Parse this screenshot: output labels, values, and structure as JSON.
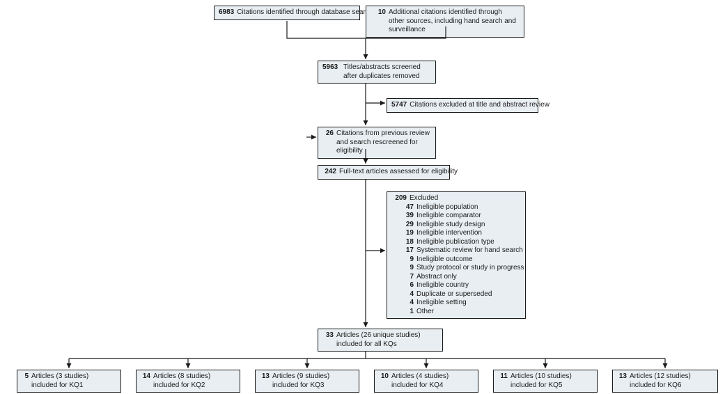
{
  "chart_data": {
    "type": "flow",
    "nodes": {
      "db_search": {
        "n": "6983",
        "label": "Citations identified through database search"
      },
      "other_sources": {
        "n": "10",
        "label": "Additional citations identified through other sources, including hand search and surveillance"
      },
      "screened": {
        "n": "5963",
        "label": "Titles/abstracts screened after duplicates removed"
      },
      "excluded_ta": {
        "n": "5747",
        "label": "Citations excluded at title and abstract review"
      },
      "prev_review": {
        "n": "26",
        "label": "Citations from previous review and search rescreened for eligibility"
      },
      "fulltext": {
        "n": "242",
        "label": "Full-text articles assessed for eligibility"
      },
      "excluded_ft": {
        "n": "209",
        "label": "Excluded",
        "reasons": [
          {
            "n": "47",
            "label": "Ineligible population"
          },
          {
            "n": "39",
            "label": "Ineligible comparator"
          },
          {
            "n": "29",
            "label": "Ineligible study design"
          },
          {
            "n": "19",
            "label": "Ineligible intervention"
          },
          {
            "n": "18",
            "label": "Ineligible publication type"
          },
          {
            "n": "17",
            "label": "Systematic review for hand search"
          },
          {
            "n": "9",
            "label": "Ineligible outcome"
          },
          {
            "n": "9",
            "label": "Study protocol or study in progress"
          },
          {
            "n": "7",
            "label": "Abstract only"
          },
          {
            "n": "6",
            "label": "Ineligible country"
          },
          {
            "n": "4",
            "label": "Duplicate or superseded"
          },
          {
            "n": "4",
            "label": "Ineligible setting"
          },
          {
            "n": "1",
            "label": "Other"
          }
        ]
      },
      "included": {
        "n": "33",
        "label": "Articles (26 unique studies) included for all KQs"
      },
      "kq": [
        {
          "n": "5",
          "label": "Articles (3 studies) included for KQ1"
        },
        {
          "n": "14",
          "label": "Articles (8 studies) included for KQ2"
        },
        {
          "n": "13",
          "label": "Articles (9 studies) included for KQ3"
        },
        {
          "n": "10",
          "label": "Articles (4 studies) included for KQ4"
        },
        {
          "n": "11",
          "label": "Articles (10 studies) included for KQ5"
        },
        {
          "n": "13",
          "label": "Articles (12 studies) included for KQ6"
        }
      ]
    }
  }
}
